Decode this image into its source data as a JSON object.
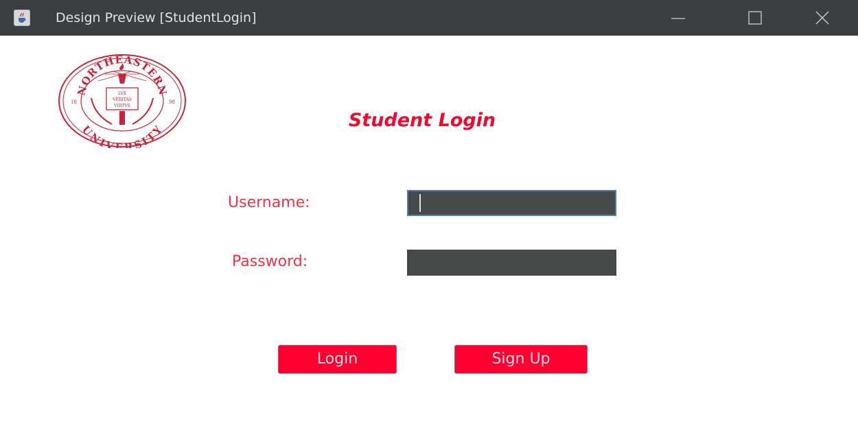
{
  "window": {
    "title": "Design Preview [StudentLogin]"
  },
  "seal": {
    "top_text": "NORTHEASTERN",
    "bottom_text": "UNIVERSITY",
    "year_left": "18",
    "year_right": "98",
    "motto_1": "LVX",
    "motto_2": "VERITAS",
    "motto_3": "VIRTVS"
  },
  "form": {
    "heading": "Student Login",
    "username_label": "Username:",
    "username_value": "",
    "password_label": "Password:",
    "password_value": ""
  },
  "buttons": {
    "login_label": "Login",
    "signup_label": "Sign Up"
  },
  "colors": {
    "accent_red": "#ee0a2c",
    "button_red": "#ff0033",
    "field_bg": "#45494a",
    "titlebar_bg": "#3c3f41"
  },
  "icons": {
    "app": "java-cup-icon",
    "minimize": "minimize-icon",
    "maximize": "maximize-icon",
    "close": "close-icon"
  }
}
